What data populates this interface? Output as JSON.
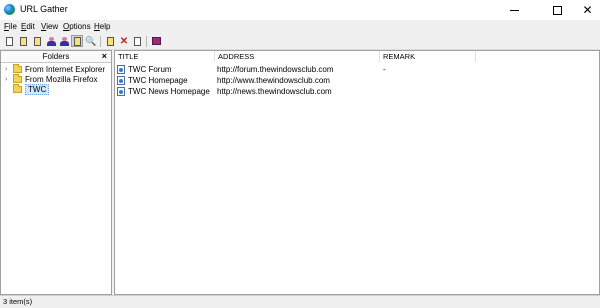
{
  "window": {
    "title": "URL Gather"
  },
  "menu": [
    {
      "label": "File"
    },
    {
      "label": "Edit"
    },
    {
      "label": "View"
    },
    {
      "label": "Options"
    },
    {
      "label": "Help"
    }
  ],
  "folders_panel": {
    "header": "Folders",
    "close_label": "×",
    "items": [
      {
        "label": "From Internet Explorer",
        "expandable": true
      },
      {
        "label": "From Mozilla Firefox",
        "expandable": true
      },
      {
        "label": "TWC",
        "selected": true
      }
    ]
  },
  "list": {
    "columns": [
      "TITLE",
      "ADDRESS",
      "REMARK"
    ],
    "rows": [
      {
        "title": "TWC Forum",
        "address": "http://forum.thewindowsclub.com",
        "remark": "-"
      },
      {
        "title": "TWC Homepage",
        "address": "http://www.thewindowsclub.com",
        "remark": ""
      },
      {
        "title": "TWC News Homepage",
        "address": "http://news.thewindowsclub.com",
        "remark": ""
      }
    ]
  },
  "status": {
    "text": "3 item(s)"
  }
}
